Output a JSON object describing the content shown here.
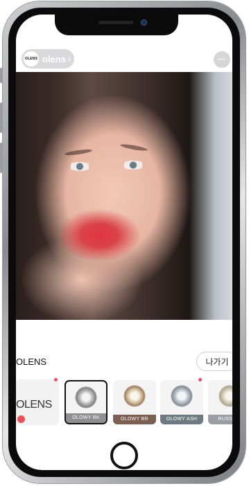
{
  "header": {
    "brand_logo_text": "OLENS",
    "brand_name": "olens",
    "brand_chevron": "›",
    "more_glyph": "•••"
  },
  "lens_panel": {
    "category": "OLENS",
    "exit_label": "나가기",
    "brand_tile_text": "OLENS",
    "lenses": [
      {
        "label": "OLOWY BK",
        "color": "#8f8f92",
        "selected": true,
        "new": true
      },
      {
        "label": "OLOWY BR",
        "color": "#7b5f52",
        "selected": false,
        "new": false
      },
      {
        "label": "OLOWY ASH",
        "color": "#6f7a80",
        "selected": false,
        "new": true
      },
      {
        "label": "RUSSIAN",
        "color": "#9a9ea3",
        "selected": false,
        "new": false
      }
    ]
  },
  "colors": {
    "accent_dot": "#e8506a",
    "selected_border": "#111111"
  }
}
